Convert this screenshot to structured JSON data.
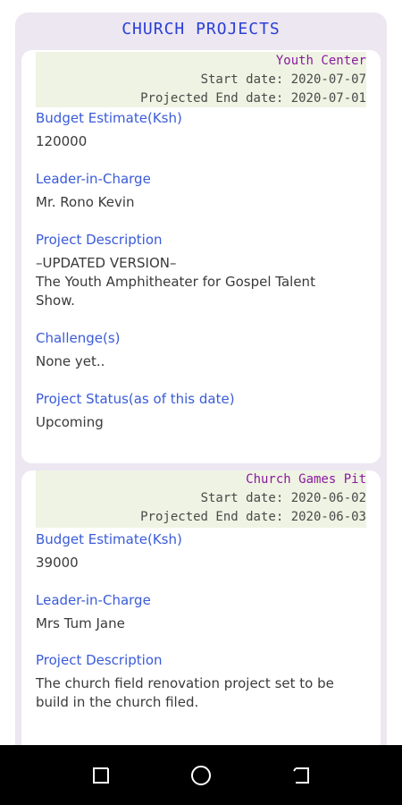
{
  "header": {
    "title": "CHURCH PROJECTS"
  },
  "projects": [
    {
      "name": "Youth Center",
      "start_date": "Start date: 2020-07-07",
      "end_date": "Projected End date: 2020-07-01",
      "budget_label": "Budget Estimate(Ksh)",
      "budget_value": "120000",
      "leader_label": "Leader-in-Charge",
      "leader_value": "Mr. Rono Kevin",
      "description_label": "Project Description",
      "description_line1": "–UPDATED VERSION–",
      "description_line2": "The Youth Amphitheater for Gospel Talent Show.",
      "challenges_label": "Challenge(s)",
      "challenges_value": "None yet..",
      "status_label": "Project Status(as of this date)",
      "status_value": "Upcoming"
    },
    {
      "name": "Church Games Pit",
      "start_date": "Start date: 2020-06-02",
      "end_date": "Projected End date: 2020-06-03",
      "budget_label": "Budget Estimate(Ksh)",
      "budget_value": "39000",
      "leader_label": "Leader-in-Charge",
      "leader_value": "Mrs Tum Jane",
      "description_label": "Project Description",
      "description_value": "The church field renovation project set to be build in the church filed."
    }
  ],
  "nav": {
    "recents_icon": "recents-icon",
    "home_icon": "home-icon",
    "back_icon": "back-icon",
    "background": "#000000"
  }
}
